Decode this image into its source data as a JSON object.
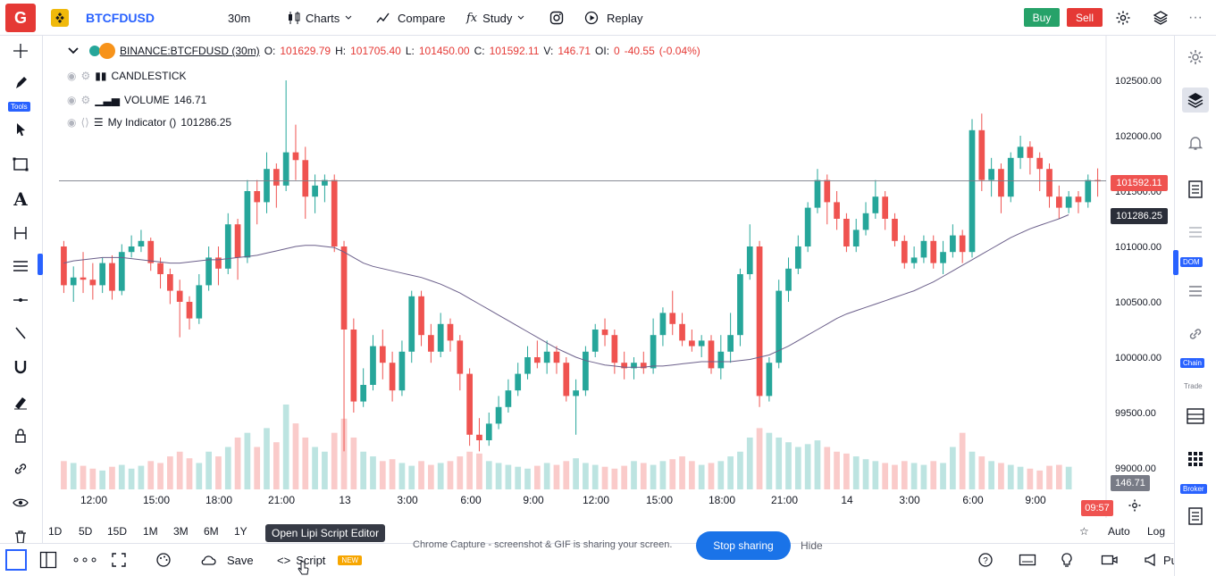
{
  "topbar": {
    "logo_letter": "G",
    "symbol": "BTCFDUSD",
    "interval": "30m",
    "charts_label": "Charts",
    "compare_label": "Compare",
    "study_label": "Study",
    "replay_label": "Replay",
    "buy_label": "Buy",
    "sell_label": "Sell"
  },
  "left_tools": {
    "tools_badge": "Tools"
  },
  "right_tools": {
    "dom_badge": "DOM",
    "chain_badge": "Chain",
    "trade_label": "Trade",
    "broker_badge": "Broker"
  },
  "legend": {
    "symbol": "BINANCE:BTCFDUSD (30m)",
    "o_label": "O:",
    "o_value": "101629.79",
    "h_label": "H:",
    "h_value": "101705.40",
    "l_label": "L:",
    "l_value": "101450.00",
    "c_label": "C:",
    "c_value": "101592.11",
    "v_label": "V:",
    "v_value": "146.71",
    "oi_label": "OI:",
    "oi_value": "0",
    "change": "-40.55",
    "change_pct": "(-0.04%)",
    "candlestick": "CANDLESTICK",
    "volume_label": "VOLUME",
    "volume_value": "146.71",
    "indicator_label": "My Indicator ()",
    "indicator_value": "101286.25"
  },
  "price_axis": {
    "ticks": [
      "102500.00",
      "102000.00",
      "101500.00",
      "101000.00",
      "100500.00",
      "100000.00",
      "99500.00",
      "99000.00"
    ],
    "last_price": "101592.11",
    "indicator_price": "101286.25",
    "volume_tag": "146.71",
    "countdown": "09:57"
  },
  "time_axis": {
    "ticks": [
      "12:00",
      "15:00",
      "18:00",
      "21:00",
      "13",
      "3:00",
      "6:00",
      "9:00",
      "12:00",
      "15:00",
      "18:00",
      "21:00",
      "14",
      "3:00",
      "6:00",
      "9:00"
    ]
  },
  "range_bar": {
    "ranges": [
      "1D",
      "5D",
      "15D",
      "1M",
      "3M",
      "6M",
      "1Y"
    ],
    "auto_label": "Auto",
    "log_label": "Log"
  },
  "bottombar": {
    "save_label": "Save",
    "script_label": "Script",
    "new_badge": "NEW",
    "publish_label": "Publish",
    "tooltip": "Open Lipi Script Editor"
  },
  "share_notice": {
    "text": "Chrome Capture - screenshot & GIF is sharing your screen.",
    "stop_label": "Stop sharing",
    "hide_label": "Hide"
  },
  "colors": {
    "up": "#26a69a",
    "down": "#ef5350",
    "accent": "#2962ff",
    "indicator": "#6b5f8a"
  },
  "chart_data": {
    "type": "candlestick",
    "symbol": "BINANCE:BTCFDUSD",
    "interval": "30m",
    "ylim": [
      98900,
      102800
    ],
    "candles": [
      [
        101000,
        100650,
        101050,
        100580
      ],
      [
        100650,
        100720,
        100820,
        100500
      ],
      [
        100720,
        100700,
        100950,
        100580
      ],
      [
        100700,
        100650,
        100850,
        100520
      ],
      [
        100650,
        100850,
        100900,
        100580
      ],
      [
        100850,
        100600,
        100920,
        100520
      ],
      [
        100600,
        100950,
        101020,
        100560
      ],
      [
        100950,
        101000,
        101100,
        100900
      ],
      [
        101000,
        101050,
        101150,
        100950
      ],
      [
        101050,
        100850,
        101080,
        100780
      ],
      [
        100850,
        100750,
        100900,
        100620
      ],
      [
        100750,
        100600,
        100800,
        100480
      ],
      [
        100600,
        100500,
        100700,
        100180
      ],
      [
        100500,
        100350,
        100550,
        100250
      ],
      [
        100350,
        100650,
        100750,
        100300
      ],
      [
        100650,
        100900,
        101000,
        100600
      ],
      [
        100900,
        100800,
        101000,
        100650
      ],
      [
        100800,
        101200,
        101300,
        100750
      ],
      [
        101200,
        100900,
        101250,
        100700
      ],
      [
        100900,
        101500,
        101600,
        100850
      ],
      [
        101500,
        101400,
        101600,
        101200
      ],
      [
        101400,
        101700,
        101850,
        101300
      ],
      [
        101700,
        101550,
        101750,
        101350
      ],
      [
        101550,
        101850,
        102500,
        101500
      ],
      [
        101850,
        101780,
        102100,
        101600
      ],
      [
        101780,
        101450,
        101900,
        101250
      ],
      [
        101450,
        101550,
        101650,
        101300
      ],
      [
        101550,
        101600,
        101650,
        101400
      ],
      [
        101600,
        101000,
        101650,
        100950
      ],
      [
        101000,
        100250,
        101050,
        99150
      ],
      [
        100250,
        99600,
        100350,
        99500
      ],
      [
        99600,
        99750,
        99900,
        99550
      ],
      [
        99750,
        100100,
        100200,
        99700
      ],
      [
        100100,
        99950,
        100250,
        99800
      ],
      [
        99950,
        99700,
        100050,
        99600
      ],
      [
        99700,
        100050,
        100150,
        99650
      ],
      [
        100050,
        100550,
        100600,
        99950
      ],
      [
        100550,
        100200,
        100600,
        100100
      ],
      [
        100200,
        100050,
        100300,
        99950
      ],
      [
        100050,
        100300,
        100400,
        100000
      ],
      [
        100300,
        100150,
        100350,
        100050
      ],
      [
        100150,
        99850,
        100200,
        99700
      ],
      [
        99850,
        99300,
        99900,
        99200
      ],
      [
        99300,
        99250,
        99450,
        99150
      ],
      [
        99250,
        99400,
        99500,
        99200
      ],
      [
        99400,
        99550,
        99650,
        99350
      ],
      [
        99550,
        99700,
        99800,
        99500
      ],
      [
        99700,
        99850,
        99950,
        99650
      ],
      [
        99850,
        100000,
        100100,
        99800
      ],
      [
        100000,
        99950,
        100150,
        99900
      ],
      [
        99950,
        100050,
        100150,
        99850
      ],
      [
        100050,
        99950,
        100100,
        99850
      ],
      [
        99950,
        99650,
        100000,
        99600
      ],
      [
        99650,
        99700,
        99800,
        99300
      ],
      [
        99700,
        100050,
        100100,
        99650
      ],
      [
        100050,
        100250,
        100300,
        100000
      ],
      [
        100250,
        100200,
        100350,
        100100
      ],
      [
        100200,
        99950,
        100250,
        99850
      ],
      [
        99950,
        99900,
        100050,
        99800
      ],
      [
        99900,
        99950,
        100000,
        99800
      ],
      [
        99950,
        99900,
        100050,
        99850
      ],
      [
        99900,
        100200,
        100350,
        99850
      ],
      [
        100200,
        100400,
        100450,
        100100
      ],
      [
        100400,
        100300,
        100600,
        100200
      ],
      [
        100300,
        100150,
        100400,
        100100
      ],
      [
        100150,
        100100,
        100250,
        100050
      ],
      [
        100100,
        100150,
        100200,
        100000
      ],
      [
        100150,
        99900,
        100200,
        99850
      ],
      [
        99900,
        100050,
        100200,
        99800
      ],
      [
        100050,
        100200,
        100400,
        99950
      ],
      [
        100200,
        100750,
        100800,
        100100
      ],
      [
        100750,
        101000,
        101200,
        100700
      ],
      [
        101000,
        99650,
        101050,
        99550
      ],
      [
        99650,
        99950,
        100000,
        99600
      ],
      [
        99950,
        100600,
        100700,
        99900
      ],
      [
        100600,
        100800,
        100900,
        100500
      ],
      [
        100800,
        101000,
        101100,
        100750
      ],
      [
        101000,
        101350,
        101400,
        100950
      ],
      [
        101350,
        101600,
        101700,
        101300
      ],
      [
        101600,
        101400,
        101650,
        101200
      ],
      [
        101400,
        101250,
        101500,
        101150
      ],
      [
        101250,
        101000,
        101300,
        100950
      ],
      [
        101000,
        101150,
        101250,
        100950
      ],
      [
        101150,
        101300,
        101400,
        101100
      ],
      [
        101300,
        101450,
        101600,
        101250
      ],
      [
        101450,
        101250,
        101500,
        101150
      ],
      [
        101250,
        101050,
        101300,
        101000
      ],
      [
        101050,
        100850,
        101100,
        100800
      ],
      [
        100850,
        100900,
        101000,
        100800
      ],
      [
        100900,
        101050,
        101100,
        100850
      ],
      [
        101050,
        100850,
        101100,
        100800
      ],
      [
        100850,
        100950,
        101050,
        100750
      ],
      [
        100950,
        101100,
        101200,
        100900
      ],
      [
        101100,
        100950,
        101150,
        100850
      ],
      [
        100950,
        102050,
        102150,
        100900
      ],
      [
        102050,
        101600,
        102200,
        101500
      ],
      [
        101600,
        101700,
        101800,
        101450
      ],
      [
        101700,
        101450,
        101750,
        101300
      ],
      [
        101450,
        101800,
        101850,
        101400
      ],
      [
        101800,
        101900,
        102000,
        101700
      ],
      [
        101900,
        101800,
        101950,
        101650
      ],
      [
        101800,
        101700,
        101850,
        101500
      ],
      [
        101700,
        101450,
        101750,
        101350
      ],
      [
        101450,
        101350,
        101550,
        101250
      ],
      [
        101350,
        101450,
        101500,
        101300
      ],
      [
        101450,
        101400,
        101500,
        101300
      ],
      [
        101400,
        101600,
        101650,
        101350
      ],
      [
        101600,
        101592,
        101705,
        101450
      ]
    ],
    "indicator_values": [
      100850,
      100870,
      100880,
      100890,
      100900,
      100900,
      100900,
      100890,
      100880,
      100870,
      100860,
      100850,
      100850,
      100860,
      100870,
      100880,
      100880,
      100890,
      100900,
      100910,
      100920,
      100940,
      100960,
      100980,
      101000,
      101010,
      101010,
      101000,
      100990,
      100950,
      100900,
      100850,
      100820,
      100800,
      100780,
      100760,
      100740,
      100720,
      100690,
      100660,
      100620,
      100580,
      100530,
      100480,
      100430,
      100380,
      100330,
      100280,
      100230,
      100180,
      100130,
      100080,
      100040,
      100000,
      99970,
      99950,
      99930,
      99920,
      99910,
      99910,
      99910,
      99920,
      99920,
      99930,
      99940,
      99950,
      99960,
      99960,
      99960,
      99960,
      99970,
      99980,
      100000,
      100020,
      100060,
      100100,
      100150,
      100200,
      100250,
      100300,
      100350,
      100390,
      100420,
      100450,
      100480,
      100510,
      100540,
      100570,
      100600,
      100640,
      100680,
      100730,
      100780,
      100830,
      100880,
      100930,
      100980,
      101030,
      101080,
      101120,
      101160,
      101190,
      101220,
      101250,
      101286
    ],
    "volume": [
      30,
      28,
      25,
      22,
      20,
      24,
      26,
      22,
      25,
      30,
      28,
      35,
      40,
      33,
      28,
      40,
      35,
      45,
      55,
      60,
      45,
      65,
      50,
      90,
      70,
      55,
      45,
      40,
      60,
      75,
      55,
      40,
      35,
      30,
      32,
      28,
      25,
      30,
      26,
      28,
      30,
      35,
      40,
      38,
      30,
      28,
      26,
      24,
      22,
      25,
      28,
      26,
      30,
      33,
      28,
      26,
      24,
      22,
      25,
      30,
      28,
      26,
      30,
      32,
      35,
      30,
      26,
      28,
      30,
      35,
      40,
      55,
      65,
      60,
      55,
      50,
      45,
      48,
      52,
      45,
      40,
      38,
      35,
      32,
      30,
      28,
      26,
      30,
      28,
      26,
      30,
      28,
      45,
      60,
      40,
      35,
      30,
      28,
      26,
      24,
      22,
      20,
      25,
      26,
      24
    ]
  }
}
